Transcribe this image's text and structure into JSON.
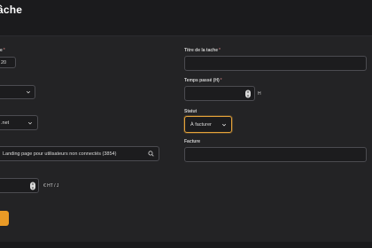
{
  "header": {
    "title": "âche"
  },
  "left": {
    "field1": {
      "label": "e",
      "value": "20"
    },
    "field3": {
      "value": ".net"
    },
    "search": {
      "value": "Landing page pour utilisateurs non connectés (3854)"
    },
    "rate": {
      "unit": "€ HT / J"
    }
  },
  "right": {
    "titre": {
      "label": "Titre de la tache",
      "value": ""
    },
    "temps": {
      "label": "Temps passé (H)",
      "value": "",
      "unit": "H"
    },
    "statut": {
      "label": "Statut",
      "value": "À facturer"
    },
    "facture": {
      "label": "Facture",
      "value": ""
    }
  },
  "icons": [
    "chevron-down-icon",
    "search-icon",
    "spinner-arrows-icon"
  ],
  "colors": {
    "accent": "#e99a26",
    "background": "#1b1b1d",
    "card": "#232325",
    "field_border": "#4b4b50"
  }
}
